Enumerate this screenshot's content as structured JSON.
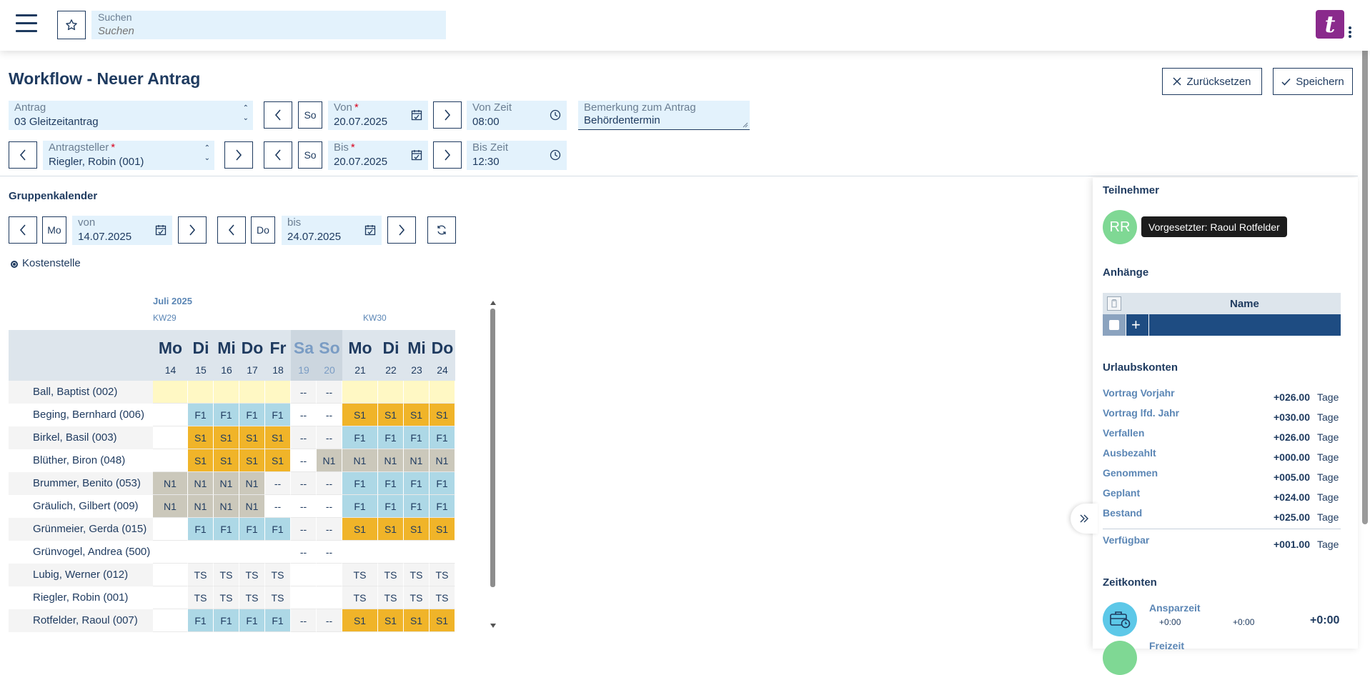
{
  "header": {
    "search_label": "Suchen",
    "search_placeholder": "Suchen",
    "logo_letter": "t"
  },
  "page": {
    "title": "Workflow - Neuer Antrag",
    "reset_label": "Zurücksetzen",
    "save_label": "Speichern"
  },
  "form": {
    "antrag_label": "Antrag",
    "antrag_value": "03 Gleitzeitantrag",
    "antragsteller_label": "Antragsteller",
    "antragsteller_value": "Riegler, Robin (001)",
    "von_label": "Von",
    "von_value": "20.07.2025",
    "von_day": "So",
    "bis_label": "Bis",
    "bis_value": "20.07.2025",
    "bis_day": "So",
    "von_zeit_label": "Von Zeit",
    "von_zeit_value": "08:00",
    "bis_zeit_label": "Bis Zeit",
    "bis_zeit_value": "12:30",
    "bemerkung_label": "Bemerkung zum Antrag",
    "bemerkung_value": "Behördentermin"
  },
  "calendar": {
    "title": "Gruppenkalender",
    "von_label": "von",
    "von_value": "14.07.2025",
    "von_day": "Mo",
    "bis_label": "bis",
    "bis_value": "24.07.2025",
    "bis_day": "Do",
    "filter_label": "Kostenstelle",
    "month": "Juli 2025",
    "kw29": "KW29",
    "kw30": "KW30",
    "days": [
      {
        "name": "Mo",
        "num": "14",
        "we": false
      },
      {
        "name": "Di",
        "num": "15",
        "we": false
      },
      {
        "name": "Mi",
        "num": "16",
        "we": false
      },
      {
        "name": "Do",
        "num": "17",
        "we": false
      },
      {
        "name": "Fr",
        "num": "18",
        "we": false
      },
      {
        "name": "Sa",
        "num": "19",
        "we": true
      },
      {
        "name": "So",
        "num": "20",
        "we": true
      },
      {
        "name": "Mo",
        "num": "21",
        "we": false
      },
      {
        "name": "Di",
        "num": "22",
        "we": false
      },
      {
        "name": "Mi",
        "num": "23",
        "we": false
      },
      {
        "name": "Do",
        "num": "24",
        "we": false
      }
    ],
    "rows": [
      {
        "name": "Ball, Baptist (002)",
        "cells": [
          "Y",
          "Y",
          "Y",
          "Y",
          "Y",
          "--",
          "--",
          "Y",
          "Y",
          "Y",
          "Y"
        ]
      },
      {
        "name": "Beging, Bernhard (006)",
        "cells": [
          "",
          "F1",
          "F1",
          "F1",
          "F1",
          "--",
          "--",
          "S1",
          "S1",
          "S1",
          "S1"
        ]
      },
      {
        "name": "Birkel, Basil (003)",
        "cells": [
          "",
          "S1",
          "S1",
          "S1",
          "S1",
          "--",
          "--",
          "F1",
          "F1",
          "F1",
          "F1"
        ]
      },
      {
        "name": "Blüther, Biron (048)",
        "cells": [
          "",
          "S1",
          "S1",
          "S1",
          "S1",
          "--",
          "N1",
          "N1",
          "N1",
          "N1",
          "N1"
        ]
      },
      {
        "name": "Brummer, Benito (053)",
        "cells": [
          "N1",
          "N1",
          "N1",
          "N1",
          "--",
          "--",
          "--",
          "F1",
          "F1",
          "F1",
          "F1"
        ]
      },
      {
        "name": "Gräulich, Gilbert (009)",
        "cells": [
          "N1",
          "N1",
          "N1",
          "N1",
          "--",
          "--",
          "--",
          "F1",
          "F1",
          "F1",
          "F1"
        ]
      },
      {
        "name": "Grünmeier, Gerda (015)",
        "cells": [
          "",
          "F1",
          "F1",
          "F1",
          "F1",
          "--",
          "--",
          "S1",
          "S1",
          "S1",
          "S1"
        ]
      },
      {
        "name": "Grünvogel, Andrea (500)",
        "cells": [
          "",
          "",
          "",
          "",
          "",
          "--",
          "--",
          "",
          "",
          "",
          ""
        ]
      },
      {
        "name": "Lubig, Werner (012)",
        "cells": [
          "",
          "TS",
          "TS",
          "TS",
          "TS",
          "",
          "",
          "TS",
          "TS",
          "TS",
          "TS"
        ]
      },
      {
        "name": "Riegler, Robin (001)",
        "cells": [
          "",
          "TS",
          "TS",
          "TS",
          "TS",
          "",
          "",
          "TS",
          "TS",
          "TS",
          "TS"
        ]
      },
      {
        "name": "Rotfelder, Raoul (007)",
        "cells": [
          "",
          "F1",
          "F1",
          "F1",
          "F1",
          "--",
          "--",
          "S1",
          "S1",
          "S1",
          "S1"
        ]
      }
    ]
  },
  "panel": {
    "teilnehmer_title": "Teilnehmer",
    "avatar_initials": "RR",
    "tooltip": "Vorgesetzter: Raoul Rotfelder",
    "anhaenge_title": "Anhänge",
    "name_col": "Name",
    "add_symbol": "+",
    "urlaub_title": "Urlaubskonten",
    "urlaub": [
      {
        "label": "Vortrag Vorjahr",
        "value": "+026.00",
        "unit": "Tage"
      },
      {
        "label": "Vortrag lfd. Jahr",
        "value": "+030.00",
        "unit": "Tage"
      },
      {
        "label": "Verfallen",
        "value": "+026.00",
        "unit": "Tage"
      },
      {
        "label": "Ausbezahlt",
        "value": "+000.00",
        "unit": "Tage"
      },
      {
        "label": "Genommen",
        "value": "+005.00",
        "unit": "Tage"
      },
      {
        "label": "Geplant",
        "value": "+024.00",
        "unit": "Tage"
      },
      {
        "label": "Bestand",
        "value": "+025.00",
        "unit": "Tage"
      }
    ],
    "verfuegbar": {
      "label": "Verfügbar",
      "value": "+001.00",
      "unit": "Tage"
    },
    "zeit_title": "Zeitkonten",
    "ansparzeit_label": "Ansparzeit",
    "ansparzeit_a": "+0:00",
    "ansparzeit_b": "+0:00",
    "ansparzeit_total": "+0:00",
    "freizeit_label": "Freizeit"
  },
  "colors": {
    "primary": "#1e3a5f",
    "field_bg": "#e3f2fc",
    "F1": "#add8e6",
    "S1": "#f0b429",
    "N1": "#cbc8bb",
    "holiday": "#fff8c4"
  }
}
